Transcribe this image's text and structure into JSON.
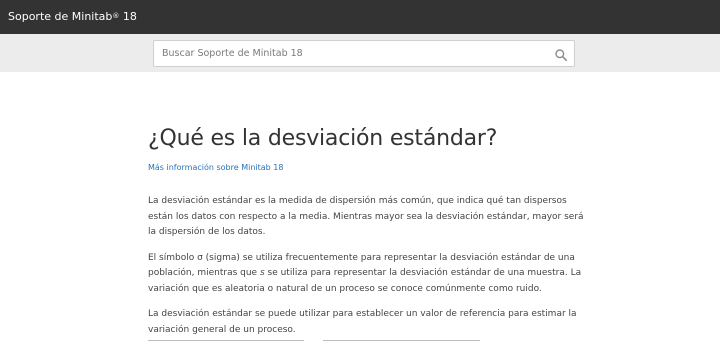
{
  "header": {
    "brand_prefix": "Soporte de Minitab",
    "brand_mark": "®",
    "brand_suffix": " 18",
    "colors": {
      "bar": "#333333",
      "text": "#ffffff"
    }
  },
  "search": {
    "placeholder": "Buscar Soporte de Minitab 18",
    "value": "",
    "icon": "search-icon"
  },
  "article": {
    "title": "¿Qué es la desviación estándar?",
    "more_link": "Más información sobre Minitab 18",
    "paragraphs": {
      "p1": "La desviación estándar es la medida de dispersión más común, que indica qué tan dispersos están los datos con respecto a la media. Mientras mayor sea la desviación estándar, mayor será la dispersión de los datos.",
      "p2_a": "El símbolo σ (sigma) se utiliza frecuentemente para representar la desviación estándar de una población, mientras que ",
      "p2_symbol": "s",
      "p2_b": " se utiliza para representar la desviación estándar de una muestra. La variación que es aleatoria o natural de un proceso se conoce comúnmente como ruido.",
      "p3": "La desviación estándar se puede utilizar para establecer un valor de referencia para estimar la variación general de un proceso."
    },
    "link_color": "#2a73b9"
  }
}
